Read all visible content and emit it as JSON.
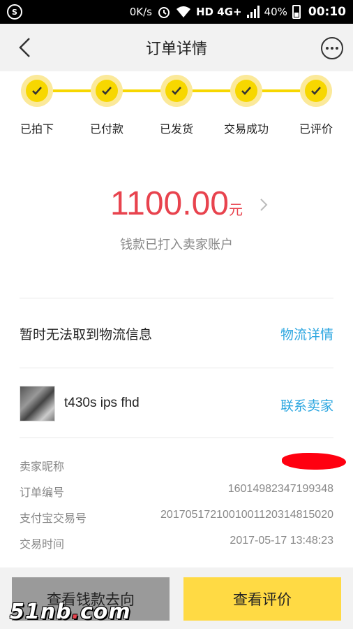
{
  "status_bar": {
    "speed": "0K/s",
    "network": "HD 4G+",
    "battery": "40%",
    "time": "00:10"
  },
  "nav": {
    "title": "订单详情"
  },
  "steps": [
    {
      "label": "已拍下"
    },
    {
      "label": "已付款"
    },
    {
      "label": "已发货"
    },
    {
      "label": "交易成功"
    },
    {
      "label": "已评价"
    }
  ],
  "amount": {
    "value": "1100.00",
    "unit": "元",
    "description": "钱款已打入卖家账户"
  },
  "logistics": {
    "label": "暂时无法取到物流信息",
    "link": "物流详情"
  },
  "product": {
    "name": "t430s ips fhd",
    "contact_link": "联系卖家"
  },
  "info": [
    {
      "key": "卖家昵称",
      "value": ""
    },
    {
      "key": "订单编号",
      "value": "16014982347199348"
    },
    {
      "key": "支付宝交易号",
      "value": "2017051721001001120314815020"
    },
    {
      "key": "交易时间",
      "value": "2017-05-17 13:48:23"
    }
  ],
  "buttons": {
    "money_flow": "查看钱款去向",
    "view_review": "查看评价"
  },
  "watermark": {
    "text_a": "51nb",
    "text_dot": ".",
    "text_b": "com"
  },
  "colors": {
    "accent_yellow": "#f7d700",
    "amount_red": "#e8434e",
    "link_blue": "#2ba6e0"
  }
}
